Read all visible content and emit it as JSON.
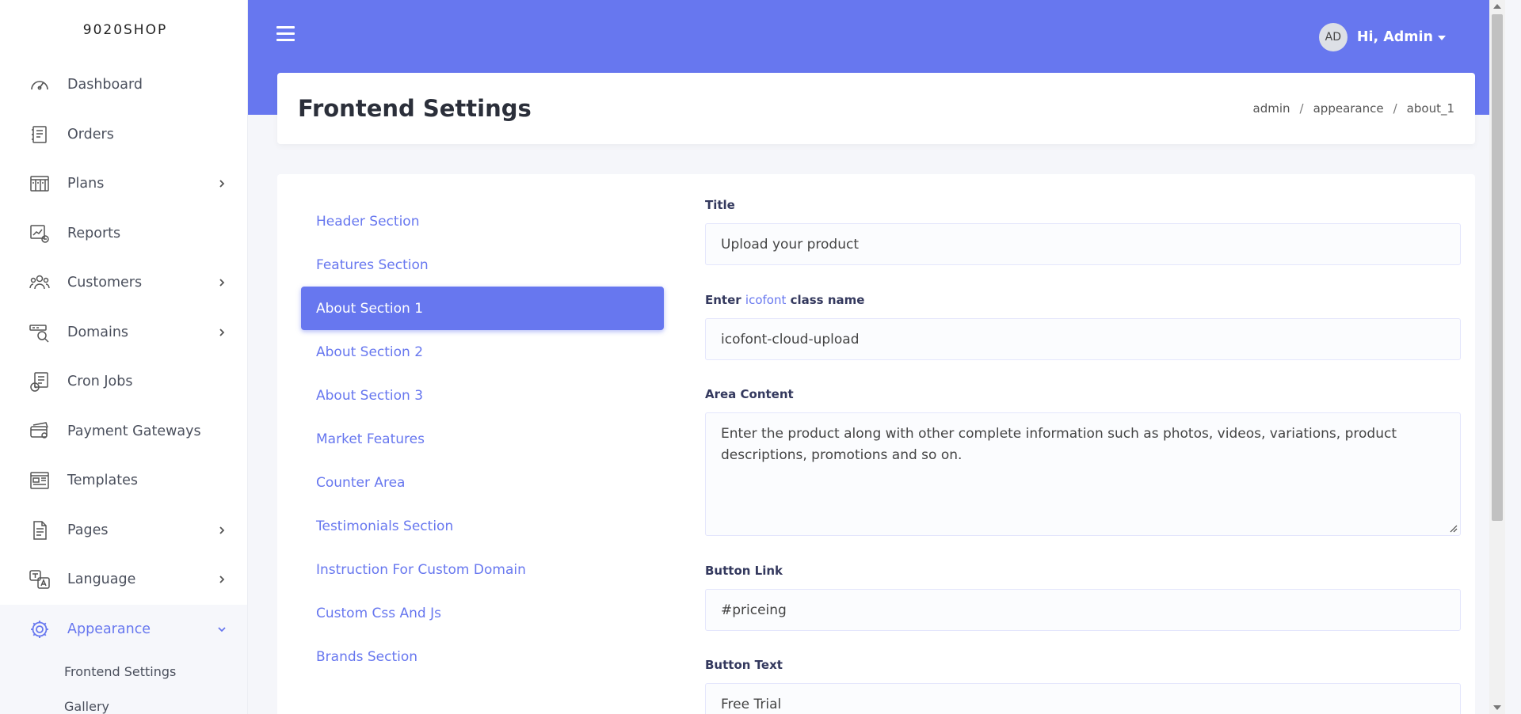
{
  "brand": "9020SHOP",
  "sidebar": {
    "items": [
      {
        "label": "Dashboard",
        "icon": "gauge-icon",
        "chevron": false
      },
      {
        "label": "Orders",
        "icon": "orders-icon",
        "chevron": false
      },
      {
        "label": "Plans",
        "icon": "plans-icon",
        "chevron": true
      },
      {
        "label": "Reports",
        "icon": "reports-icon",
        "chevron": false
      },
      {
        "label": "Customers",
        "icon": "customers-icon",
        "chevron": true
      },
      {
        "label": "Domains",
        "icon": "domains-icon",
        "chevron": true
      },
      {
        "label": "Cron Jobs",
        "icon": "cron-icon",
        "chevron": false
      },
      {
        "label": "Payment Gateways",
        "icon": "payment-icon",
        "chevron": false
      },
      {
        "label": "Templates",
        "icon": "templates-icon",
        "chevron": false
      },
      {
        "label": "Pages",
        "icon": "pages-icon",
        "chevron": true
      },
      {
        "label": "Language",
        "icon": "language-icon",
        "chevron": true
      },
      {
        "label": "Appearance",
        "icon": "gear-icon",
        "chevron": true
      }
    ],
    "subitems": [
      "Frontend Settings",
      "Gallery"
    ]
  },
  "header": {
    "avatar_initials": "AD",
    "user_greeting": "Hi, Admin"
  },
  "page": {
    "title": "Frontend Settings",
    "breadcrumb": [
      "admin",
      "appearance",
      "about_1"
    ]
  },
  "sections": [
    "Header Section",
    "Features Section",
    "About Section 1",
    "About Section 2",
    "About Section 3",
    "Market Features",
    "Counter Area",
    "Testimonials Section",
    "Instruction For Custom Domain",
    "Custom Css And Js",
    "Brands Section"
  ],
  "form": {
    "title_label": "Title",
    "title_value": "Upload your product",
    "icon_label_prefix": "Enter",
    "icon_label_link": "icofont",
    "icon_label_suffix": "class name",
    "icon_value": "icofont-cloud-upload",
    "content_label": "Area Content",
    "content_value": "Enter the product along with other complete information such as photos, videos, variations, product descriptions, promotions and so on.",
    "button_link_label": "Button Link",
    "button_link_value": "#priceing",
    "button_text_label": "Button Text",
    "button_text_value": "Free Trial"
  },
  "colors": {
    "accent": "#6777ef",
    "sidebar_bg": "#ffffff",
    "page_bg": "#f5f6fa"
  }
}
